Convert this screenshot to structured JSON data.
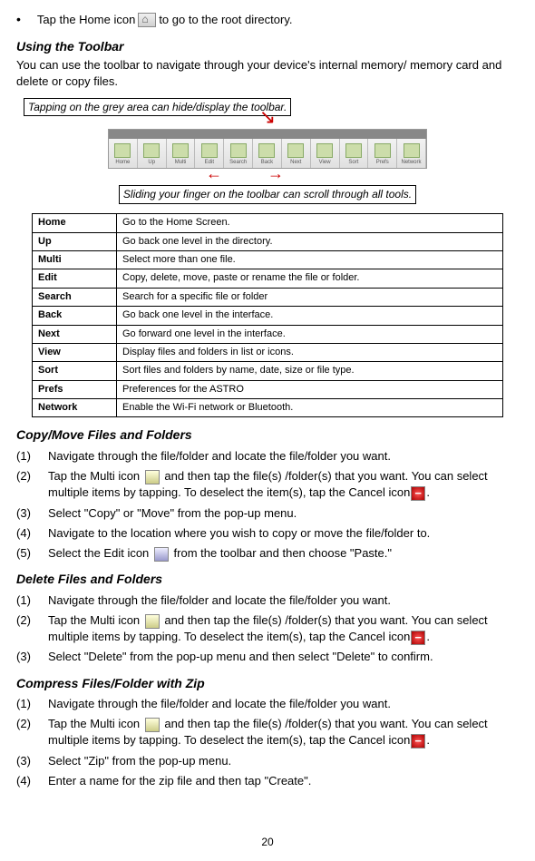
{
  "intro": {
    "bullet_text_before": "Tap the Home icon ",
    "bullet_text_after": " to go to the root directory."
  },
  "section1": {
    "heading": "Using the Toolbar",
    "para": "You can use the toolbar to navigate through your device's internal memory/ memory card and delete or copy files.",
    "callout_top": "Tapping on the grey area can hide/display the toolbar.",
    "callout_bottom": "Sliding your finger on the toolbar can scroll through all tools.",
    "toolbar_labels": [
      "Home",
      "Up",
      "Multi",
      "Edit",
      "Search",
      "Back",
      "Next",
      "View",
      "Sort",
      "Prefs",
      "Network"
    ]
  },
  "table": [
    {
      "name": "Home",
      "desc": "Go to the Home Screen."
    },
    {
      "name": "Up",
      "desc": "Go back one level in the directory."
    },
    {
      "name": "Multi",
      "desc": "Select more than one file."
    },
    {
      "name": "Edit",
      "desc": "Copy, delete, move, paste or rename the file or folder."
    },
    {
      "name": "Search",
      "desc": "Search for a specific file or folder"
    },
    {
      "name": "Back",
      "desc": "Go back one level in the interface."
    },
    {
      "name": "Next",
      "desc": "Go forward one level in the interface."
    },
    {
      "name": "View",
      "desc": "Display files and folders in list or icons."
    },
    {
      "name": "Sort",
      "desc": "Sort files and folders by name, date, size or file type."
    },
    {
      "name": "Prefs",
      "desc": "Preferences for the ASTRO"
    },
    {
      "name": "Network",
      "desc": "Enable the Wi-Fi network or Bluetooth."
    }
  ],
  "section2": {
    "heading": "Copy/Move Files and Folders",
    "steps": {
      "s1": "Navigate through the file/folder and locate the file/folder you want.",
      "s2a": "Tap the Multi icon ",
      "s2b": " and then tap the file(s) /folder(s) that you want. You can select multiple items by tapping. To deselect the item(s), tap the Cancel icon",
      "s2c": ".",
      "s3": "Select \"Copy\" or \"Move\" from the pop-up menu.",
      "s4": "Navigate to the location where you wish to copy or move the file/folder to.",
      "s5a": "Select the Edit icon ",
      "s5b": " from the toolbar and then choose \"Paste.\""
    }
  },
  "section3": {
    "heading": "Delete Files and Folders",
    "steps": {
      "s1": "Navigate through the file/folder and locate the file/folder you want.",
      "s2a": "Tap the Multi icon ",
      "s2b": " and then tap the file(s) /folder(s) that you want. You can select multiple items by tapping. To deselect the item(s), tap the Cancel icon",
      "s2c": ".",
      "s3": "Select \"Delete\" from the pop-up menu and then select \"Delete\" to confirm."
    }
  },
  "section4": {
    "heading": "Compress Files/Folder with Zip",
    "steps": {
      "s1": "Navigate through the file/folder and locate the file/folder you want.",
      "s2a": "Tap the Multi icon ",
      "s2b": " and then tap the file(s) /folder(s) that you want. You can select multiple items by tapping. To deselect the item(s), tap the Cancel icon",
      "s2c": ".",
      "s3": "Select \"Zip\" from the pop-up menu.",
      "s4": "Enter a name for the zip file and then tap \"Create\"."
    }
  },
  "page_number": "20"
}
